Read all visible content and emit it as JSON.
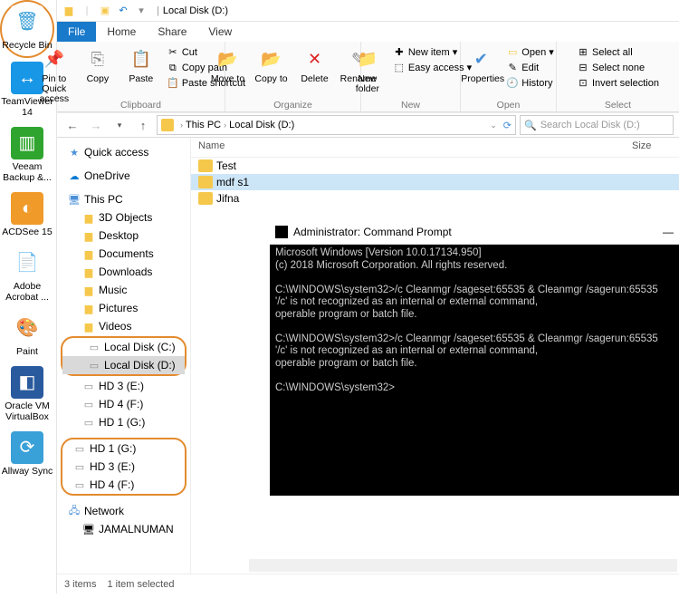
{
  "desktop": {
    "items": [
      {
        "label": "Recycle Bin",
        "bg": "#ffffff",
        "glyph": "🗑",
        "text": "#3aa0d8",
        "annot": true
      },
      {
        "label": "TeamViewer 14",
        "bg": "#1897e6",
        "glyph": "↔"
      },
      {
        "label": "Veeam Backup &...",
        "bg": "#2fa52f",
        "glyph": "▥"
      },
      {
        "label": "ACDSee 15",
        "bg": "#f09a2a",
        "glyph": "◐"
      },
      {
        "label": "Adobe Acrobat ...",
        "bg": "#ffffff",
        "glyph": "📄",
        "text": "#d00"
      },
      {
        "label": "Paint",
        "bg": "#ffffff",
        "glyph": "🎨"
      },
      {
        "label": "Oracle VM VirtualBox",
        "bg": "#2a5a9e",
        "glyph": "◧"
      },
      {
        "label": "Allway Sync",
        "bg": "#3aa0d8",
        "glyph": "⟳"
      }
    ]
  },
  "explorer": {
    "title": "Local Disk (D:)",
    "tabs": {
      "file": "File",
      "home": "Home",
      "share": "Share",
      "view": "View"
    },
    "ribbon": {
      "clipboard": {
        "label": "Clipboard",
        "pin": "Pin to Quick access",
        "copy": "Copy",
        "paste": "Paste",
        "cut": "Cut",
        "copypath": "Copy path",
        "pasteshortcut": "Paste shortcut"
      },
      "organize": {
        "label": "Organize",
        "move": "Move to",
        "copy": "Copy to",
        "delete": "Delete",
        "rename": "Rename"
      },
      "new": {
        "label": "New",
        "folder": "New folder",
        "item": "New item",
        "easy": "Easy access"
      },
      "open": {
        "label": "Open",
        "props": "Properties",
        "open": "Open",
        "edit": "Edit",
        "history": "History"
      },
      "select": {
        "label": "Select",
        "all": "Select all",
        "none": "Select none",
        "invert": "Invert selection"
      }
    },
    "breadcrumb": {
      "pc": "This PC",
      "loc": "Local Disk (D:)"
    },
    "search_placeholder": "Search Local Disk (D:)",
    "nav": {
      "quick": "Quick access",
      "onedrive": "OneDrive",
      "thispc": "This PC",
      "subs": [
        "3D Objects",
        "Desktop",
        "Documents",
        "Downloads",
        "Music",
        "Pictures",
        "Videos"
      ],
      "drives1": [
        "Local Disk (C:)",
        "Local Disk (D:)"
      ],
      "drives2": [
        "HD 3 (E:)",
        "HD 4 (F:)",
        "HD 1 (G:)"
      ],
      "drives3": [
        "HD 1 (G:)",
        "HD 3 (E:)",
        "HD 4 (F:)"
      ],
      "network": "Network",
      "net_items": [
        "JAMALNUMAN"
      ]
    },
    "columns": {
      "name": "Name",
      "size": "Size"
    },
    "rows": [
      {
        "name": "Test",
        "sel": false
      },
      {
        "name": "mdf s1",
        "sel": true
      },
      {
        "name": "Jifna",
        "sel": false
      }
    ],
    "status": {
      "items": "3 items",
      "selected": "1 item selected"
    }
  },
  "cmd": {
    "title": "Administrator: Command Prompt",
    "body": "Microsoft Windows [Version 10.0.17134.950]\n(c) 2018 Microsoft Corporation. All rights reserved.\n\nC:\\WINDOWS\\system32>/c Cleanmgr /sageset:65535 & Cleanmgr /sagerun:65535\n'/c' is not recognized as an internal or external command,\noperable program or batch file.\n\nC:\\WINDOWS\\system32>/c Cleanmgr /sageset:65535 & Cleanmgr /sagerun:65535\n'/c' is not recognized as an internal or external command,\noperable program or batch file.\n\nC:\\WINDOWS\\system32>"
  }
}
